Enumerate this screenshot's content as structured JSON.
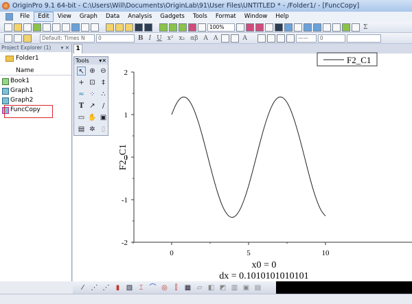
{
  "window": {
    "title": "OriginPro 9.1 64-bit - C:\\Users\\Will\\Documents\\OriginLab\\91\\User Files\\UNTITLED * - /Folder1/ - [FuncCopy]"
  },
  "menu": [
    "File",
    "Edit",
    "View",
    "Graph",
    "Data",
    "Analysis",
    "Gadgets",
    "Tools",
    "Format",
    "Window",
    "Help"
  ],
  "menu_active": "Edit",
  "toolbar": {
    "zoom": "100%",
    "font": "Default: Times N",
    "font_size": "0",
    "line_width": "0",
    "bold": "B",
    "italic": "I",
    "underline": "U",
    "greek": "αβ",
    "sigma": "Σ"
  },
  "project_explorer": {
    "title": "Project Explorer (1)",
    "folder": "Folder1",
    "column": "Name",
    "items": [
      {
        "label": "Book1",
        "type": "workbook"
      },
      {
        "label": "Graph1",
        "type": "graph"
      },
      {
        "label": "Graph2",
        "type": "graph"
      },
      {
        "label": "FuncCopy",
        "type": "graph",
        "highlighted": true
      }
    ]
  },
  "graph": {
    "tab": "1"
  },
  "tools_panel": {
    "title": "Tools"
  },
  "colors": {
    "highlight": "#d9262b",
    "title_bar": "#a9c6ea"
  },
  "chart_data": {
    "type": "line",
    "xlabel": "",
    "ylabel": "F2_C1",
    "annotations": [
      "x0 = 0",
      "dx = 0.1010101010101"
    ],
    "xlim": [
      -2.5,
      11.5
    ],
    "ylim": [
      -2,
      2
    ],
    "xticks": [
      0,
      5,
      10
    ],
    "yticks": [
      -2,
      -1,
      0,
      1,
      2
    ],
    "grid": false,
    "legend": "top-right",
    "series": [
      {
        "name": "F2_C1",
        "x": [
          0,
          0.25,
          0.5,
          0.75,
          1,
          1.25,
          1.5,
          1.75,
          2,
          2.25,
          2.5,
          2.75,
          3,
          3.25,
          3.5,
          3.75,
          4,
          4.25,
          4.5,
          4.75,
          5,
          5.25,
          5.5,
          5.75,
          6,
          6.25,
          6.5,
          6.75,
          7,
          7.25,
          7.5,
          7.75,
          8,
          8.25,
          8.5,
          8.75,
          9,
          9.25,
          9.5,
          9.75,
          10
        ],
        "y": [
          1.0,
          1.216,
          1.357,
          1.413,
          1.382,
          1.265,
          1.068,
          0.806,
          0.493,
          0.15,
          -0.202,
          -0.541,
          -0.848,
          -1.103,
          -1.287,
          -1.393,
          -1.411,
          -1.341,
          -1.188,
          -0.96,
          -0.675,
          -0.347,
          0.003,
          0.352,
          0.679,
          0.964,
          1.191,
          1.343,
          1.412,
          1.391,
          1.284,
          1.098,
          0.843,
          0.534,
          0.195,
          -0.158,
          -0.505,
          -0.819,
          -1.079,
          -1.271,
          -1.383
        ]
      }
    ]
  }
}
